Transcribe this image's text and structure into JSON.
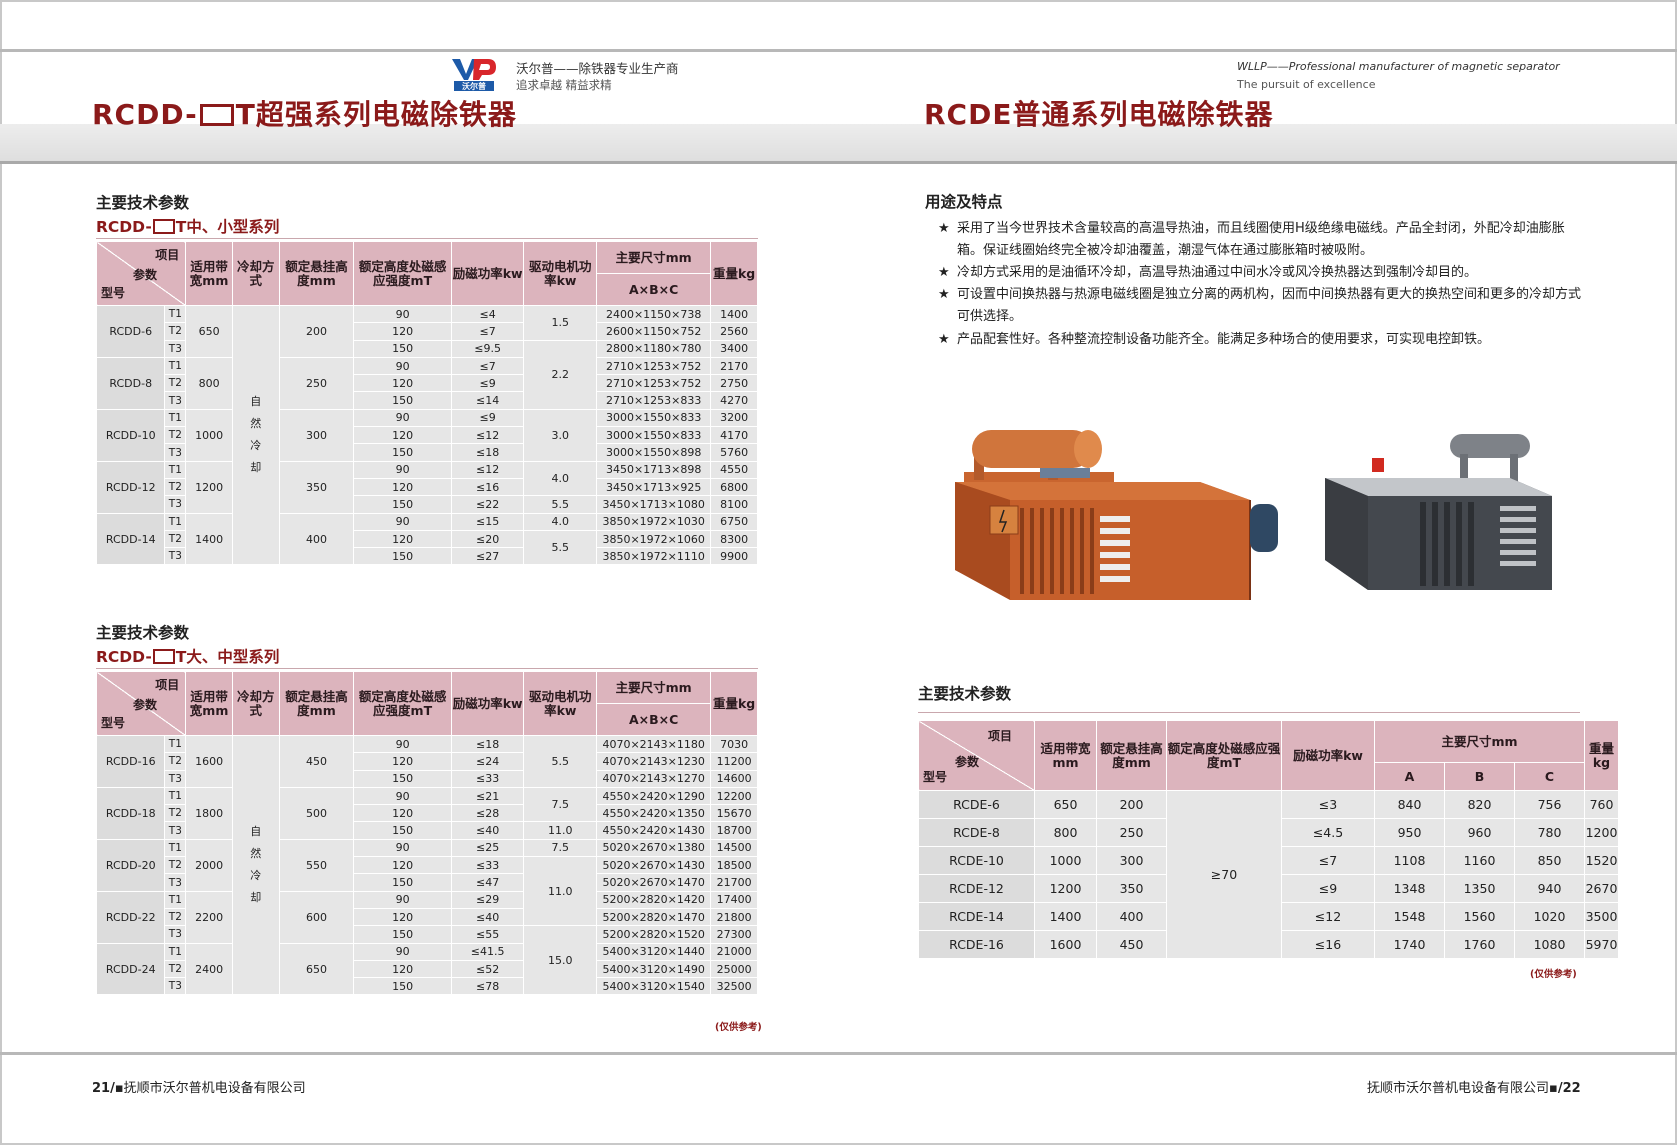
{
  "brand": {
    "logo_text": "沃尔普",
    "cn_line1": "沃尔普——除铁器专业生产商",
    "cn_line2": "追求卓越  精益求精",
    "en_line1": "WLLP——Professional manufacturer of magnetic separator",
    "en_line2": "The pursuit of excellence"
  },
  "left_title": {
    "prefix": "RCDD-",
    "suffix": "T超强系列电磁除铁器"
  },
  "right_title": "RCDE普通系列电磁除铁器",
  "section1": {
    "heading": "主要技术参数",
    "sub_prefix": "RCDD-",
    "sub_suffix": "T中、小型系列"
  },
  "section2": {
    "heading": "主要技术参数",
    "sub_prefix": "RCDD-",
    "sub_suffix": "T大、中型系列"
  },
  "rcdd_headers": {
    "item": "项目",
    "param": "参数",
    "model": "型号",
    "belt": "适用带宽mm",
    "cooling": "冷却方式",
    "height": "额定悬挂高度mm",
    "induction": "额定高度处磁感应强度mT",
    "power": "励磁功率kw",
    "motor": "驱动电机功率kw",
    "dims": "主要尺寸mm",
    "dims_sub": "A×B×C",
    "weight": "重量kg"
  },
  "cooling_chars": [
    "自",
    "然",
    "冷",
    "却"
  ],
  "table1": {
    "groups": [
      {
        "model": "RCDD-6",
        "belt": "650",
        "height": "200"
      },
      {
        "model": "RCDD-8",
        "belt": "800",
        "height": "250"
      },
      {
        "model": "RCDD-10",
        "belt": "1000",
        "height": "300"
      },
      {
        "model": "RCDD-12",
        "belt": "1200",
        "height": "350"
      },
      {
        "model": "RCDD-14",
        "belt": "1400",
        "height": "400"
      }
    ],
    "rows": [
      [
        "T1",
        "90",
        "≤4",
        "1.5",
        "2400×1150×738",
        "1400"
      ],
      [
        "T2",
        "120",
        "≤7",
        "",
        "2600×1150×752",
        "2560"
      ],
      [
        "T3",
        "150",
        "≤9.5",
        "2.2",
        "2800×1180×780",
        "3400"
      ],
      [
        "T1",
        "90",
        "≤7",
        "",
        "2710×1253×752",
        "2170"
      ],
      [
        "T2",
        "120",
        "≤9",
        "",
        "2710×1253×752",
        "2750"
      ],
      [
        "T3",
        "150",
        "≤14",
        "",
        "2710×1253×833",
        "4270"
      ],
      [
        "T1",
        "90",
        "≤9",
        "3.0",
        "3000×1550×833",
        "3200"
      ],
      [
        "T2",
        "120",
        "≤12",
        "",
        "3000×1550×833",
        "4170"
      ],
      [
        "T3",
        "150",
        "≤18",
        "",
        "3000×1550×898",
        "5760"
      ],
      [
        "T1",
        "90",
        "≤12",
        "4.0",
        "3450×1713×898",
        "4550"
      ],
      [
        "T2",
        "120",
        "≤16",
        "",
        "3450×1713×925",
        "6800"
      ],
      [
        "T3",
        "150",
        "≤22",
        "5.5",
        "3450×1713×1080",
        "8100"
      ],
      [
        "T1",
        "90",
        "≤15",
        "4.0",
        "3850×1972×1030",
        "6750"
      ],
      [
        "T2",
        "120",
        "≤20",
        "5.5",
        "3850×1972×1060",
        "8300"
      ],
      [
        "T3",
        "150",
        "≤27",
        "",
        "3850×1972×1110",
        "9900"
      ]
    ]
  },
  "table2": {
    "groups": [
      {
        "model": "RCDD-16",
        "belt": "1600",
        "height": "450"
      },
      {
        "model": "RCDD-18",
        "belt": "1800",
        "height": "500"
      },
      {
        "model": "RCDD-20",
        "belt": "2000",
        "height": "550"
      },
      {
        "model": "RCDD-22",
        "belt": "2200",
        "height": "600"
      },
      {
        "model": "RCDD-24",
        "belt": "2400",
        "height": "650"
      }
    ],
    "rows": [
      [
        "T1",
        "90",
        "≤18",
        "5.5",
        "4070×2143×1180",
        "7030"
      ],
      [
        "T2",
        "120",
        "≤24",
        "",
        "4070×2143×1230",
        "11200"
      ],
      [
        "T3",
        "150",
        "≤33",
        "",
        "4070×2143×1270",
        "14600"
      ],
      [
        "T1",
        "90",
        "≤21",
        "7.5",
        "4550×2420×1290",
        "12200"
      ],
      [
        "T2",
        "120",
        "≤28",
        "",
        "4550×2420×1350",
        "15670"
      ],
      [
        "T3",
        "150",
        "≤40",
        "11.0",
        "4550×2420×1430",
        "18700"
      ],
      [
        "T1",
        "90",
        "≤25",
        "7.5",
        "5020×2670×1380",
        "14500"
      ],
      [
        "T2",
        "120",
        "≤33",
        "11.0",
        "5020×2670×1430",
        "18500"
      ],
      [
        "T3",
        "150",
        "≤47",
        "",
        "5020×2670×1470",
        "21700"
      ],
      [
        "T1",
        "90",
        "≤29",
        "",
        "5200×2820×1420",
        "17400"
      ],
      [
        "T2",
        "120",
        "≤40",
        "",
        "5200×2820×1470",
        "21800"
      ],
      [
        "T3",
        "150",
        "≤55",
        "15.0",
        "5200×2820×1520",
        "27300"
      ],
      [
        "T1",
        "90",
        "≤41.5",
        "",
        "5400×3120×1440",
        "21000"
      ],
      [
        "T2",
        "120",
        "≤52",
        "",
        "5400×3120×1490",
        "25000"
      ],
      [
        "T3",
        "150",
        "≤78",
        "",
        "5400×3120×1540",
        "32500"
      ]
    ]
  },
  "note": "(仅供参考)",
  "features": {
    "heading": "用途及特点",
    "star": "★",
    "items": [
      "采用了当今世界技术含量较高的高温导热油，而且线圈使用H级绝缘电磁线。产品全封闭，外配冷却油膨胀箱。保证线圈始终完全被冷却油覆盖，潮湿气体在通过膨胀箱时被吸附。",
      "冷却方式采用的是油循环冷却，高温导热油通过中间水冷或风冷换热器达到强制冷却目的。",
      "可设置中间换热器与热源电磁线圈是独立分离的两机构，因而中间换热器有更大的换热空间和更多的冷却方式可供选择。",
      "产品配套性好。各种整流控制设备功能齐全。能满足多种场合的使用要求，可实现电控卸铁。"
    ]
  },
  "section3": {
    "heading": "主要技术参数"
  },
  "rcde_headers": {
    "item": "项目",
    "param": "参数",
    "model": "型号",
    "belt": "适用带宽mm",
    "height": "额定悬挂高度mm",
    "induction": "额定高度处磁感应强度mT",
    "power": "励磁功率kw",
    "dims": "主要尺寸mm",
    "a": "A",
    "b": "B",
    "c": "C",
    "weight": "重量kg"
  },
  "rcde_induction": "≥70",
  "rcde_rows": [
    [
      "RCDE-6",
      "650",
      "200",
      "≤3",
      "840",
      "820",
      "756",
      "760"
    ],
    [
      "RCDE-8",
      "800",
      "250",
      "≤4.5",
      "950",
      "960",
      "780",
      "1200"
    ],
    [
      "RCDE-10",
      "1000",
      "300",
      "≤7",
      "1108",
      "1160",
      "850",
      "1520"
    ],
    [
      "RCDE-12",
      "1200",
      "350",
      "≤9",
      "1348",
      "1350",
      "940",
      "2670"
    ],
    [
      "RCDE-14",
      "1400",
      "400",
      "≤12",
      "1548",
      "1560",
      "1020",
      "3500"
    ],
    [
      "RCDE-16",
      "1600",
      "450",
      "≤16",
      "1740",
      "1760",
      "1080",
      "5970"
    ]
  ],
  "footer": {
    "left_page": "21/",
    "dot": "▪",
    "company": "抚顺市沃尔普机电设备有限公司",
    "right_page": "/22"
  },
  "colors": {
    "accent": "#8b1a1a",
    "header_cell": "#dcb4bd",
    "data_cell": "#e6e6e6",
    "logo_blue": "#1d5aa8"
  }
}
